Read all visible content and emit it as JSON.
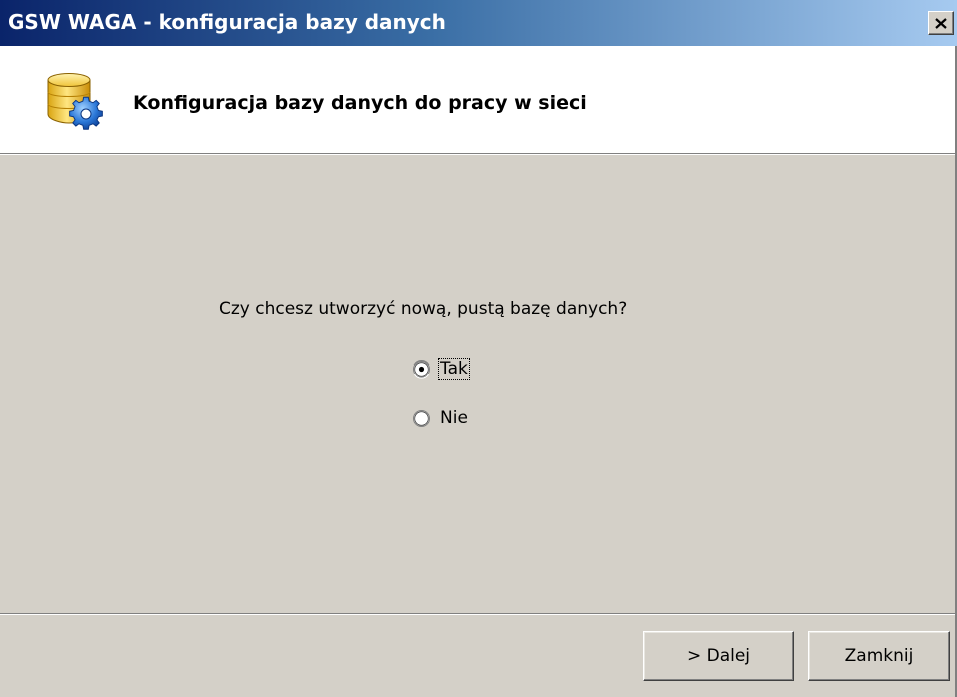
{
  "window": {
    "title": "GSW WAGA - konfiguracja bazy danych",
    "close_symbol": "×"
  },
  "header": {
    "title": "Konfiguracja bazy danych do pracy w sieci",
    "icon": "database-gear-icon"
  },
  "main": {
    "question": "Czy chcesz utworzyć nową, pustą bazę danych?",
    "options": [
      {
        "label": "Tak",
        "selected": true
      },
      {
        "label": "Nie",
        "selected": false
      }
    ]
  },
  "footer": {
    "next_label": "> Dalej",
    "close_label": "Zamknij"
  },
  "colors": {
    "title_bar_start": "#0a246a",
    "title_bar_end": "#a6caf0",
    "face": "#d4d0c8",
    "header_bg": "#ffffff"
  }
}
